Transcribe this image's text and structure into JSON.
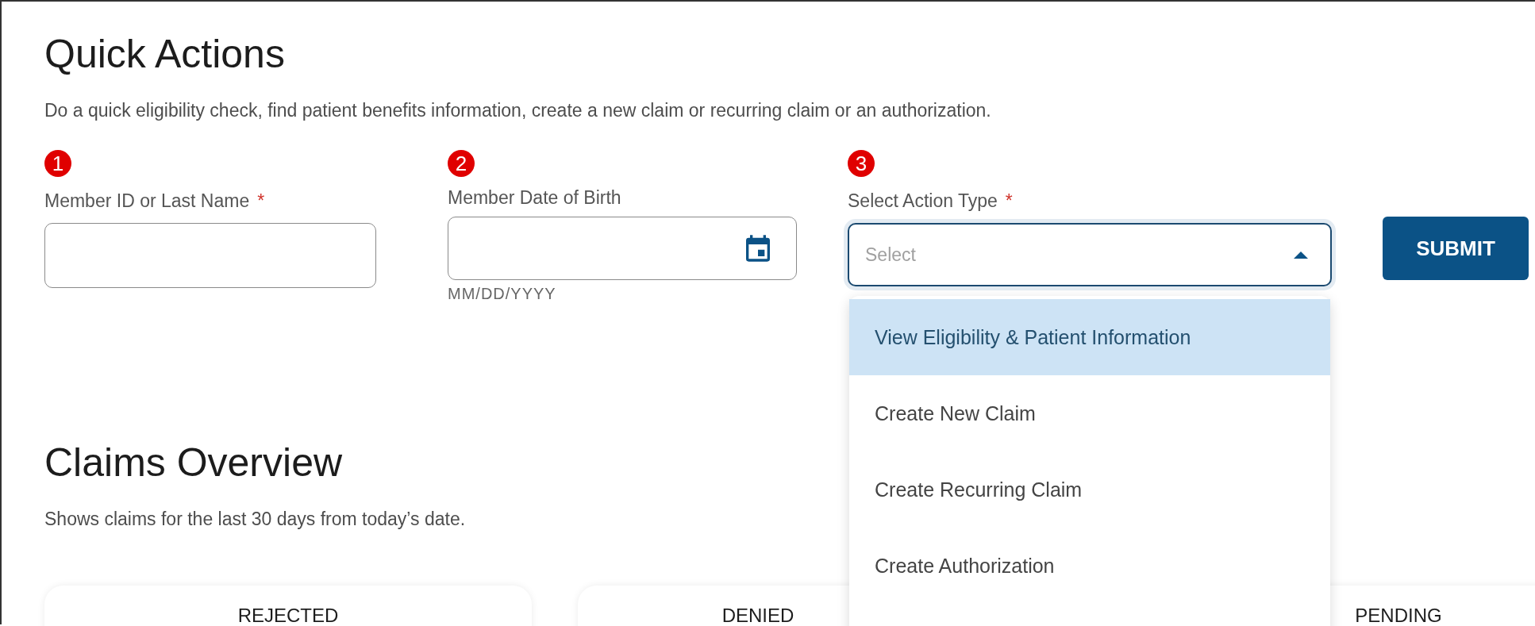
{
  "quick_actions": {
    "title": "Quick Actions",
    "description": "Do a quick eligibility check, find patient benefits information, create a new claim or recurring claim or an authorization.",
    "fields": [
      {
        "kind": "text",
        "marker": "1",
        "label": "Member ID or Last Name",
        "required": true,
        "required_mark": "*"
      },
      {
        "kind": "date",
        "marker": "2",
        "label": "Member Date of Birth",
        "required": false,
        "hint": "MM/DD/YYYY"
      },
      {
        "kind": "select",
        "marker": "3",
        "label": "Select Action Type",
        "required": true,
        "required_mark": "*",
        "placeholder": "Select",
        "expanded": true,
        "options": [
          {
            "label": "View Eligibility & Patient Information",
            "selected": true
          },
          {
            "label": "Create New Claim",
            "selected": false
          },
          {
            "label": "Create Recurring Claim",
            "selected": false
          },
          {
            "label": "Create Authorization",
            "selected": false
          }
        ]
      }
    ],
    "submit": "SUBMIT"
  },
  "claims_overview": {
    "title": "Claims Overview",
    "description": "Shows claims for the last 30 days from today’s date.",
    "cards": [
      {
        "title": "REJECTED"
      },
      {
        "title": "DENIED"
      },
      {
        "title": "PENDING"
      }
    ]
  }
}
